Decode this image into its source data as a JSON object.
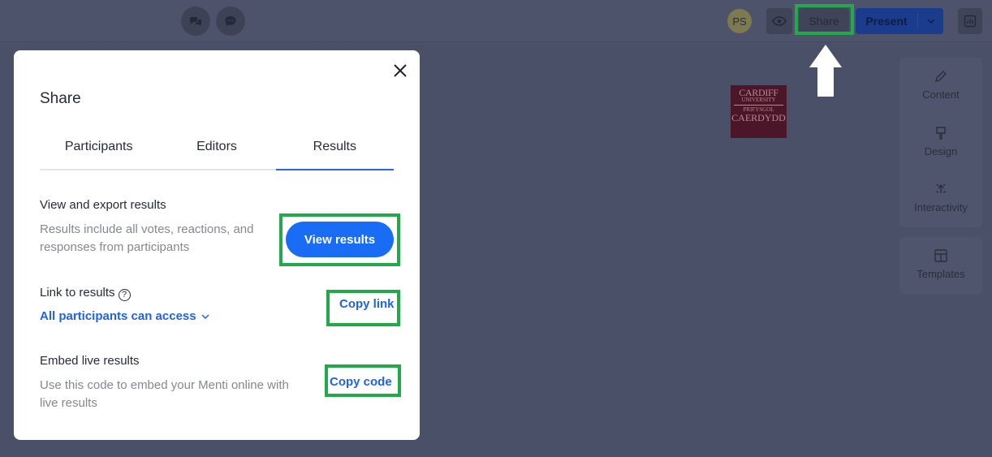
{
  "topbar": {
    "avatar_initials": "PS",
    "share_label": "Share",
    "present_label": "Present"
  },
  "sidebar": {
    "items": [
      {
        "label": "Content",
        "icon": "pencil-icon"
      },
      {
        "label": "Design",
        "icon": "paintbrush-icon"
      },
      {
        "label": "Interactivity",
        "icon": "interactivity-icon"
      },
      {
        "label": "Templates",
        "icon": "templates-icon"
      }
    ]
  },
  "logo": {
    "line1": "CARDIFF",
    "line2": "UNIVERSITY",
    "line3": "PRIFYSGOL",
    "line4": "CAERDYDD"
  },
  "dialog": {
    "title": "Share",
    "tabs": [
      {
        "label": "Participants",
        "active": false
      },
      {
        "label": "Editors",
        "active": false
      },
      {
        "label": "Results",
        "active": true
      }
    ],
    "view_export": {
      "heading": "View and export results",
      "description": "Results include all votes, reactions, and responses from participants",
      "button": "View results"
    },
    "link": {
      "heading": "Link to results",
      "access": "All participants can access",
      "button": "Copy link"
    },
    "embed": {
      "heading": "Embed live results",
      "description": "Use this code to embed your Menti online with live results",
      "button": "Copy code"
    }
  },
  "colors": {
    "accent": "#196cf4",
    "link": "#1f63e6",
    "highlight": "#23a84a",
    "overlay": "#4a5068"
  }
}
